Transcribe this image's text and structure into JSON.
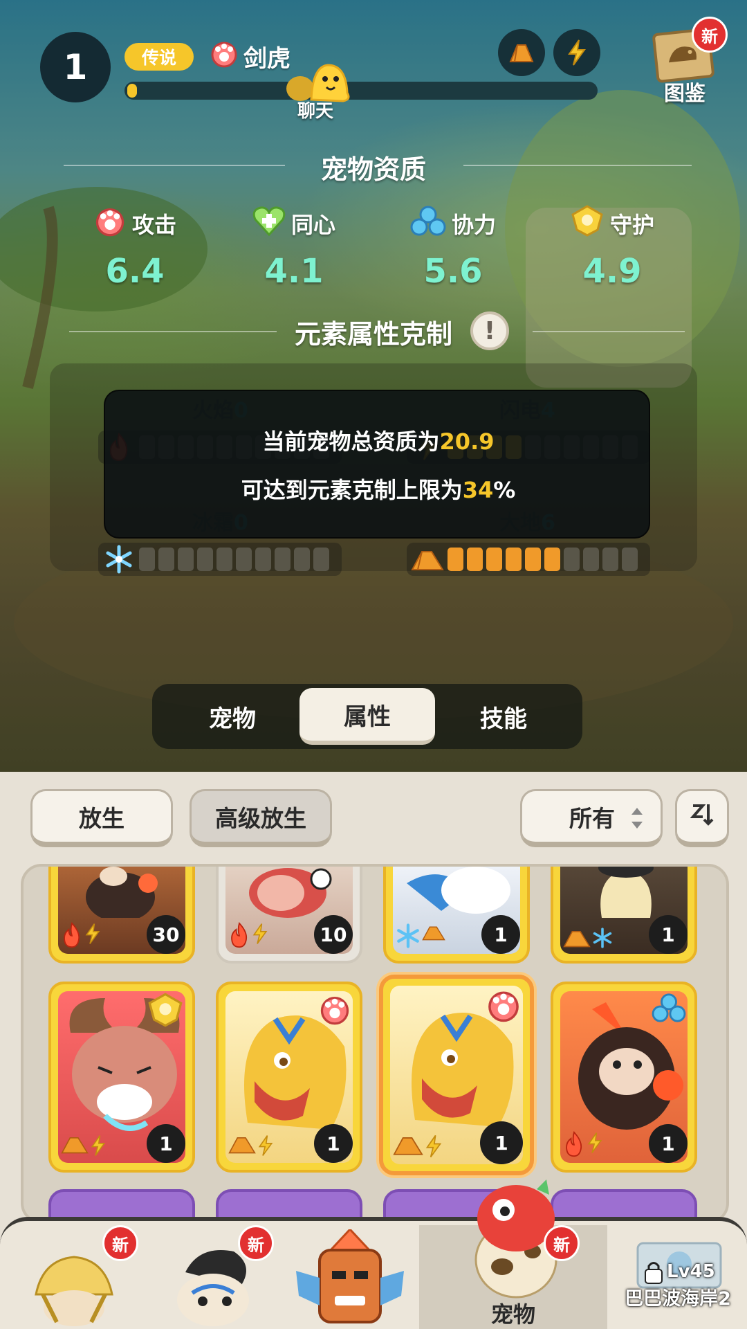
{
  "header": {
    "level": "1",
    "rarity": "传说",
    "pet_name": "剑虎",
    "xp_fraction": 0.02,
    "chat_label": "聊天",
    "codex_label": "图鉴",
    "new_badge": "新"
  },
  "qualities": {
    "title": "宠物资质",
    "stats": [
      {
        "label": "攻击",
        "value": "6.4",
        "icon": "attack-paw-icon"
      },
      {
        "label": "同心",
        "value": "4.1",
        "icon": "heart-icon"
      },
      {
        "label": "协力",
        "value": "5.6",
        "icon": "teamwork-icon"
      },
      {
        "label": "守护",
        "value": "4.9",
        "icon": "shield-icon"
      }
    ]
  },
  "elements": {
    "title": "元素属性克制",
    "items": [
      {
        "name": "火焰",
        "value": "0",
        "icon": "fire-icon",
        "filled": 0
      },
      {
        "name": "闪电",
        "value": "4",
        "icon": "lightning-icon",
        "filled": 4
      },
      {
        "name": "冰霜",
        "value": "0",
        "icon": "snowflake-icon",
        "filled": 0
      },
      {
        "name": "大地",
        "value": "6",
        "icon": "earth-icon",
        "filled": 6
      }
    ],
    "segments_total": 10
  },
  "tooltip": {
    "line1_prefix": "当前宠物总资质为",
    "line1_value": "20.9",
    "line2_prefix": "可达到元素克制上限为",
    "line2_value": "34",
    "line2_suffix": "%"
  },
  "tabs": [
    {
      "label": "宠物",
      "active": false
    },
    {
      "label": "属性",
      "active": true
    },
    {
      "label": "技能",
      "active": false
    }
  ],
  "toolbar": {
    "release_label": "放生",
    "advanced_release_label": "高级放生",
    "filter_label": "所有",
    "sort_icon": "sort-icon"
  },
  "pet_grid": {
    "row1": [
      {
        "count": "30",
        "elements": [
          "fire",
          "lightning"
        ],
        "frame": "gold"
      },
      {
        "count": "10",
        "elements": [
          "fire",
          "lightning"
        ],
        "frame": "gray"
      },
      {
        "count": "1",
        "elements": [
          "snowflake",
          "earth"
        ],
        "frame": "gold"
      },
      {
        "count": "1",
        "elements": [
          "earth",
          "snowflake"
        ],
        "frame": "gold"
      }
    ],
    "row2": [
      {
        "count": "1",
        "elements": [
          "earth",
          "lightning"
        ],
        "frame": "gold",
        "type": "shield"
      },
      {
        "count": "1",
        "elements": [
          "earth",
          "lightning"
        ],
        "frame": "gold",
        "type": "attack"
      },
      {
        "count": "1",
        "elements": [
          "earth",
          "lightning"
        ],
        "frame": "gold",
        "type": "attack",
        "selected": true
      },
      {
        "count": "1",
        "elements": [
          "fire",
          "lightning"
        ],
        "frame": "gold",
        "type": "teamwork"
      }
    ]
  },
  "bottom_nav": {
    "items": [
      {
        "label": "",
        "new": "新"
      },
      {
        "label": "",
        "new": "新"
      },
      {
        "label": ""
      },
      {
        "label": "宠物",
        "new": "新",
        "active": true
      },
      {
        "label": "巴巴波海岸2",
        "lock": "Lv45"
      }
    ]
  },
  "colors": {
    "accent_gold": "#f6c62a",
    "stat_value": "#7ef2d0",
    "earth_orange": "#f09a2a",
    "new_red": "#e23030"
  }
}
